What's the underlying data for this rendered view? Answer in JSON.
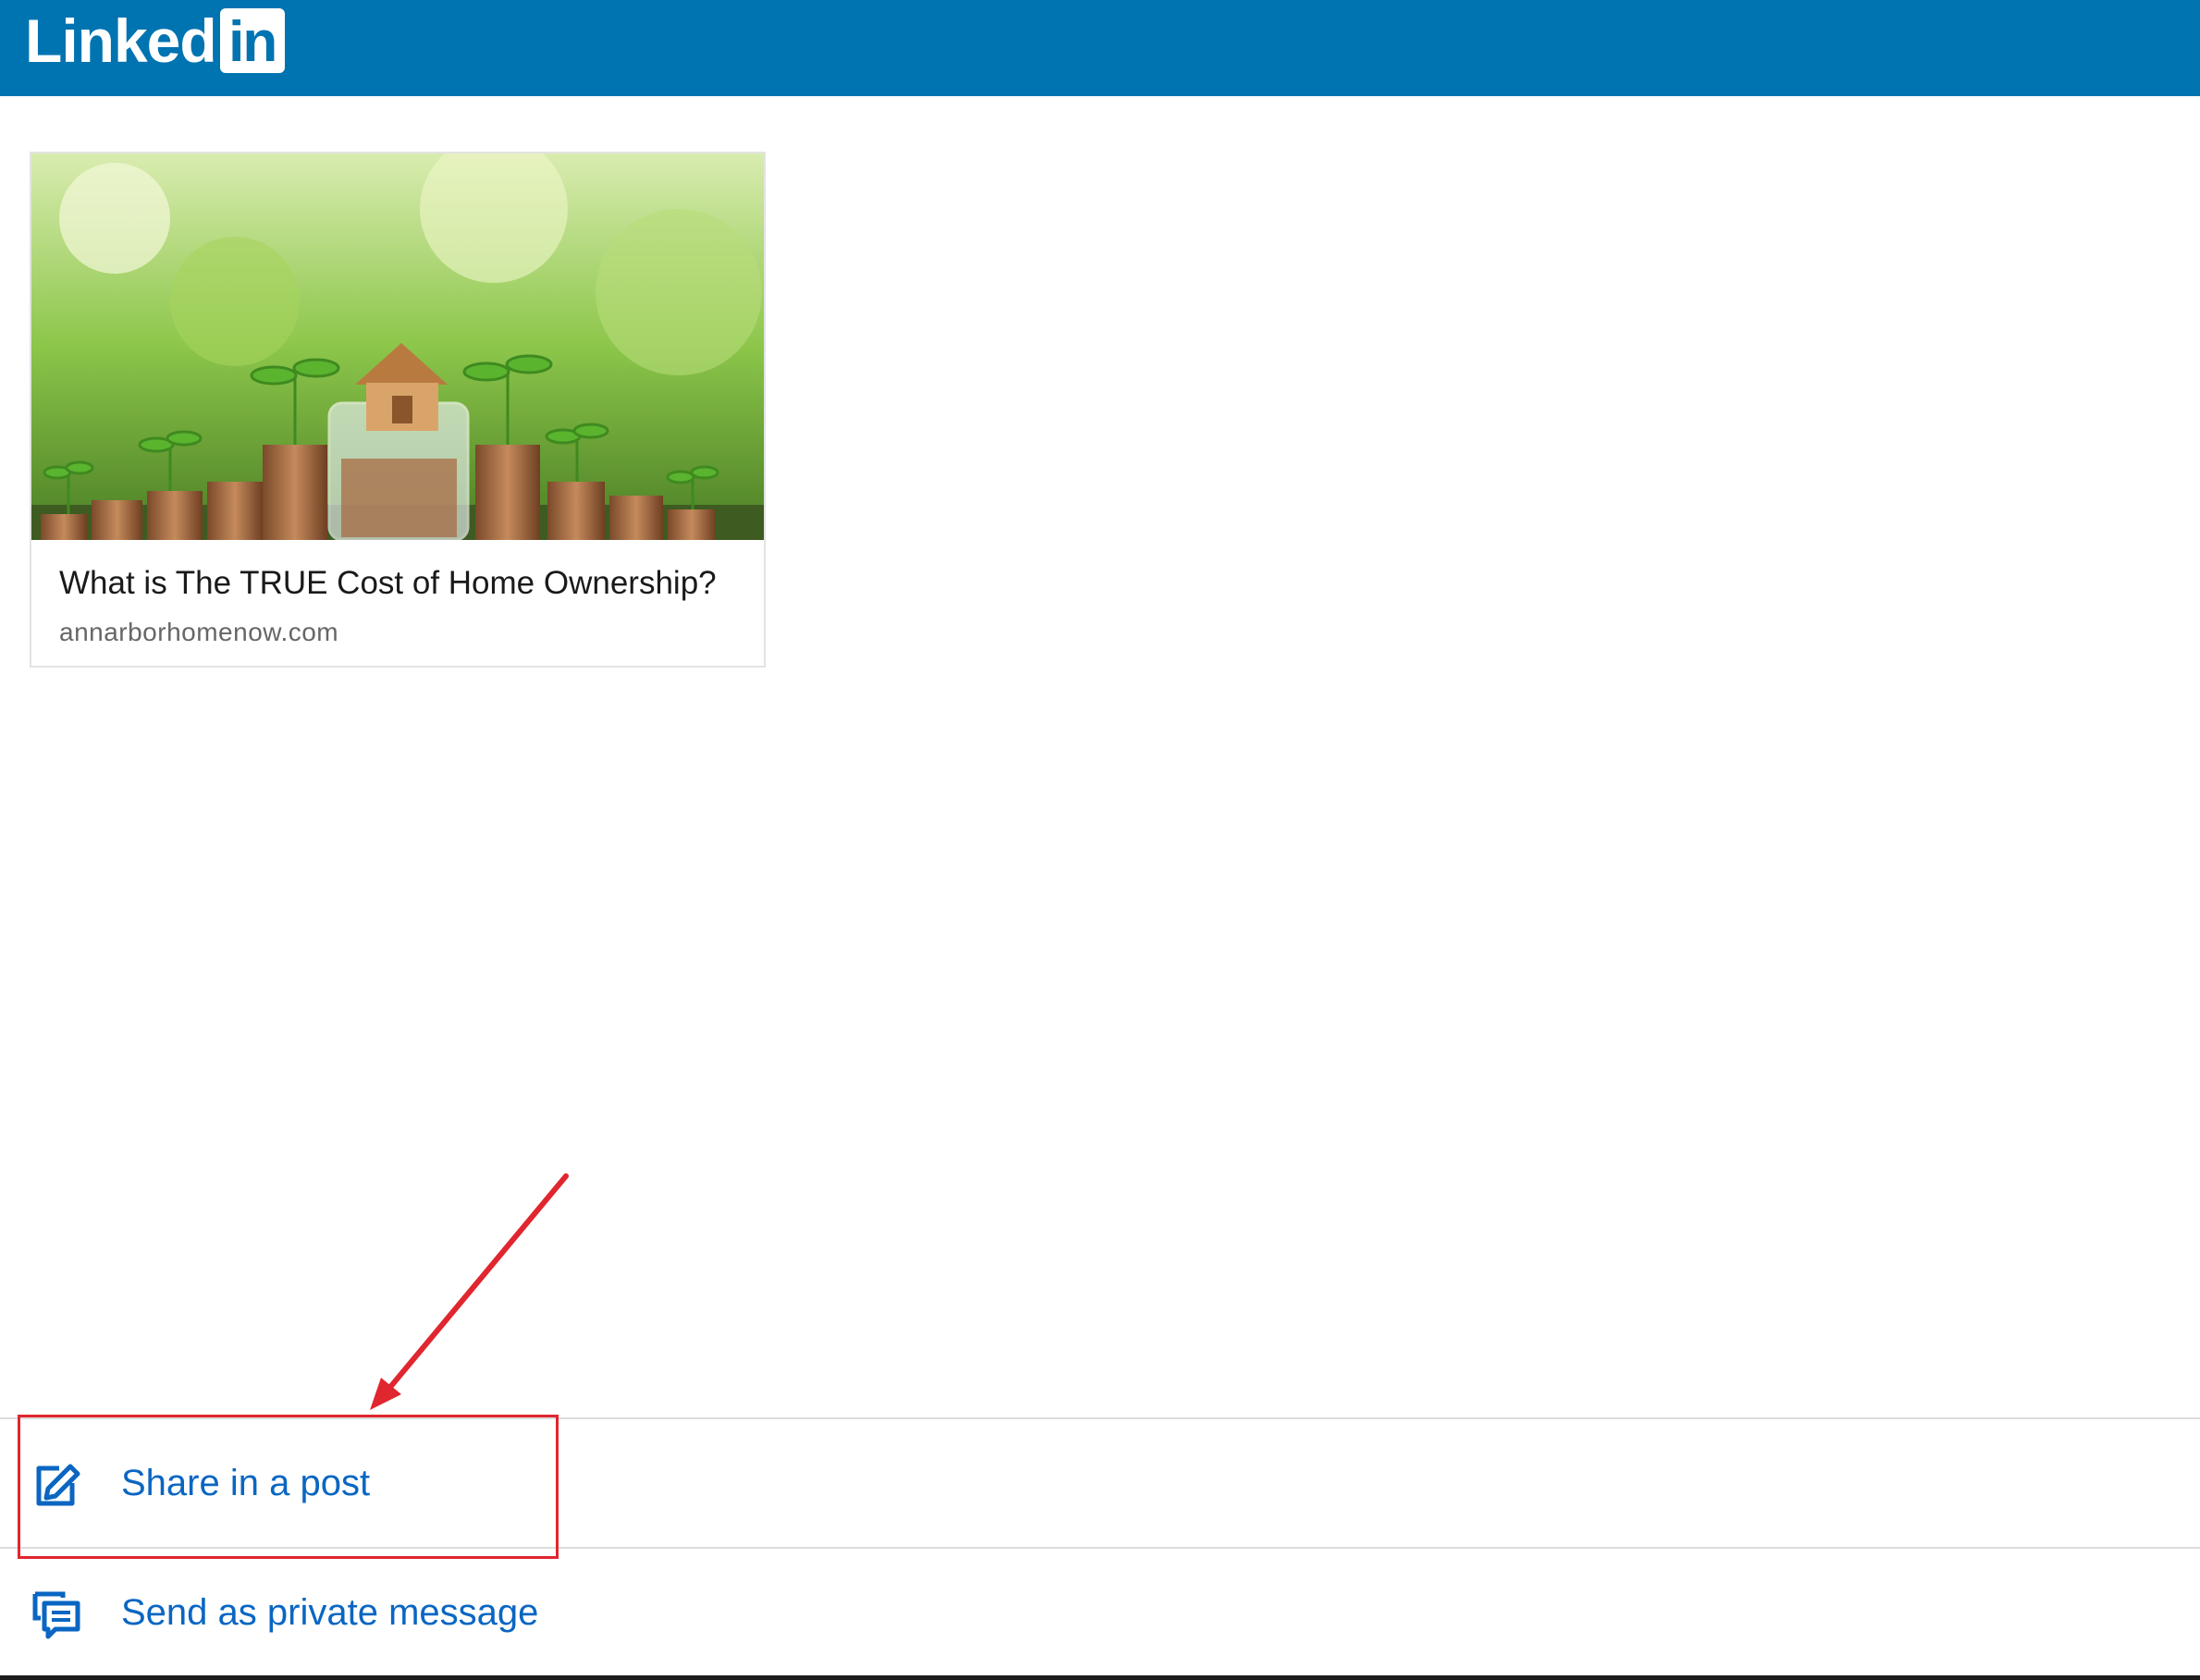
{
  "header": {
    "logo_word": "Linked",
    "logo_box": "in",
    "brand_color": "#0073b1"
  },
  "card": {
    "title": "What is The TRUE Cost of Home Ownership?",
    "domain": "annarborhomenow.com"
  },
  "actions": [
    {
      "label": "Share in a post",
      "icon": "edit-icon"
    },
    {
      "label": "Send as private message",
      "icon": "message-icon"
    }
  ],
  "colors": {
    "action_text": "#0a66c2",
    "annotation": "#e0262f"
  }
}
